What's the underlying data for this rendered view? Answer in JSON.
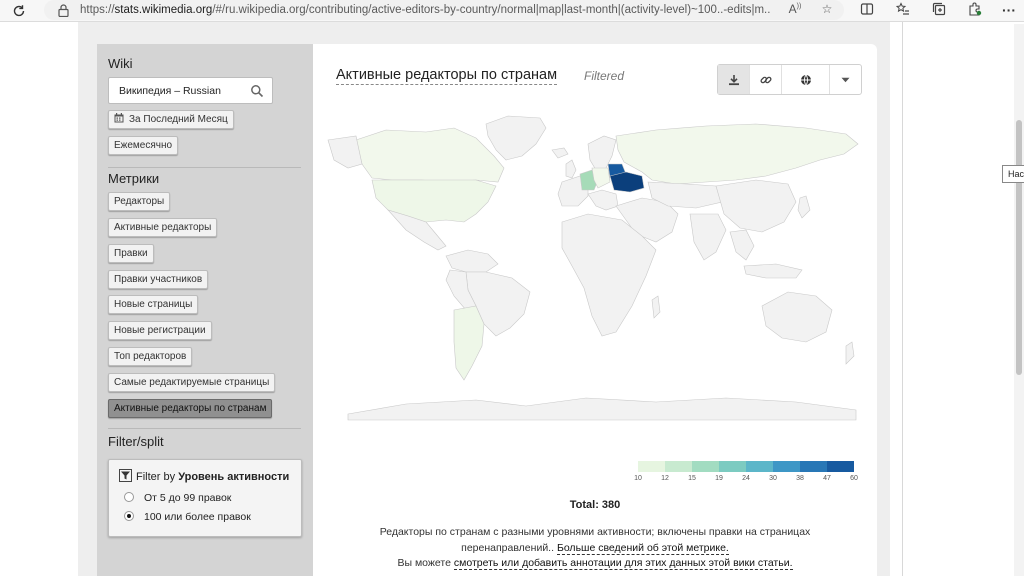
{
  "browser": {
    "url_prefix": "https://",
    "url_host": "stats.wikimedia.org",
    "url_rest": "/#/ru.wikipedia.org/contributing/active-editors-by-country/normal|map|last-month|(activity-level)~100..-edits|m...",
    "icons": [
      "refresh-icon",
      "lock-icon",
      "read-aloud-icon",
      "favorite-icon",
      "split-screen-icon",
      "favorites-list-icon",
      "collections-icon",
      "extension-icon",
      "more-icon"
    ]
  },
  "sidebar": {
    "wiki_heading": "Wiki",
    "wiki_search_value": "Википедия – Russian",
    "time_range_button": "За Последний Месяц",
    "granularity_button": "Ежемесячно",
    "metrics_heading": "Метрики",
    "metrics": [
      "Редакторы",
      "Активные редакторы",
      "Правки",
      "Правки участников",
      "Новые страницы",
      "Новые регистрации",
      "Топ редакторов",
      "Самые редактируемые страницы",
      "Активные редакторы по странам"
    ],
    "active_metric_index": 8,
    "filter_heading": "Filter/split",
    "filter": {
      "label_prefix": "Filter by",
      "label_bold": "Уровень активности",
      "options": [
        "От 5 до 99 правок",
        "100 или более правок"
      ],
      "selected_index": 1
    }
  },
  "main": {
    "title": "Активные редакторы по странам",
    "filtered_tag": "Filtered",
    "toolbar": [
      "download-icon",
      "link-icon",
      "globe-icon",
      "chevron-down-icon"
    ],
    "total": "Total: 380",
    "description_line1": "Редакторы по странам с разными уровнями активности; включены правки на страницах",
    "description_line2_plain": "перенаправлений..",
    "description_line2_link": "Больше сведений об этой метрике.",
    "description_line3_plain": "Вы можете",
    "description_line3_link": "смотреть или добавить аннотации для этих данных этой вики статьи."
  },
  "chart_data": {
    "type": "map",
    "legend_thresholds": [
      "10",
      "12",
      "15",
      "19",
      "24",
      "30",
      "38",
      "47",
      "60"
    ],
    "legend_colors": [
      "#e6f5e0",
      "#c8ead0",
      "#a2dcc1",
      "#7ccbc1",
      "#5cb6c9",
      "#3e97c6",
      "#2877b6",
      "#175aa0",
      "#0b3f7c"
    ],
    "highlighted_regions": [
      {
        "region": "Russia",
        "color": "#f2f8ec"
      },
      {
        "region": "Canada",
        "color": "#f2f8ec"
      },
      {
        "region": "USA",
        "color": "#eef7e8"
      },
      {
        "region": "Argentina",
        "color": "#eef7e8"
      },
      {
        "region": "Germany",
        "color": "#a6dbb8"
      },
      {
        "region": "Ukraine",
        "color": "#0b3f7c"
      },
      {
        "region": "Belarus",
        "color": "#175aa0"
      }
    ],
    "total": 380
  }
}
